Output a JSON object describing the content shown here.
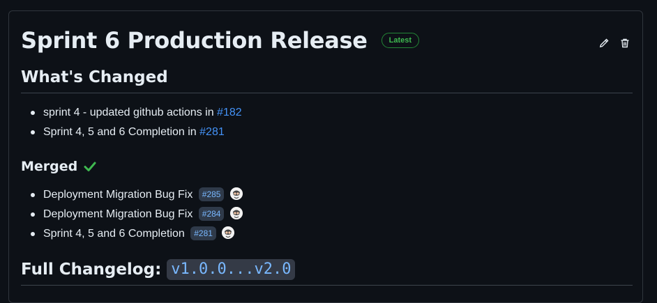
{
  "release": {
    "title": "Sprint 6 Production Release",
    "badge": "Latest"
  },
  "actions": {
    "edit_icon": "pencil-icon",
    "delete_icon": "trash-icon"
  },
  "whats_changed": {
    "heading": "What's Changed",
    "items": [
      {
        "text": "sprint 4 - updated github actions in ",
        "link": "#182"
      },
      {
        "text": "Sprint 4, 5 and 6 Completion in ",
        "link": "#281"
      }
    ]
  },
  "merged": {
    "heading": "Merged",
    "items": [
      {
        "text": "Deployment Migration Bug Fix",
        "pr": "#285"
      },
      {
        "text": "Deployment Migration Bug Fix",
        "pr": "#284"
      },
      {
        "text": "Sprint 4, 5 and 6 Completion",
        "pr": "#281"
      }
    ]
  },
  "changelog": {
    "label": "Full Changelog:",
    "range": "v1.0.0...v2.0"
  },
  "colors": {
    "background": "#0d1117",
    "link": "#4493f8",
    "badge_green": "#3fb950",
    "check_green": "#3fb950"
  }
}
